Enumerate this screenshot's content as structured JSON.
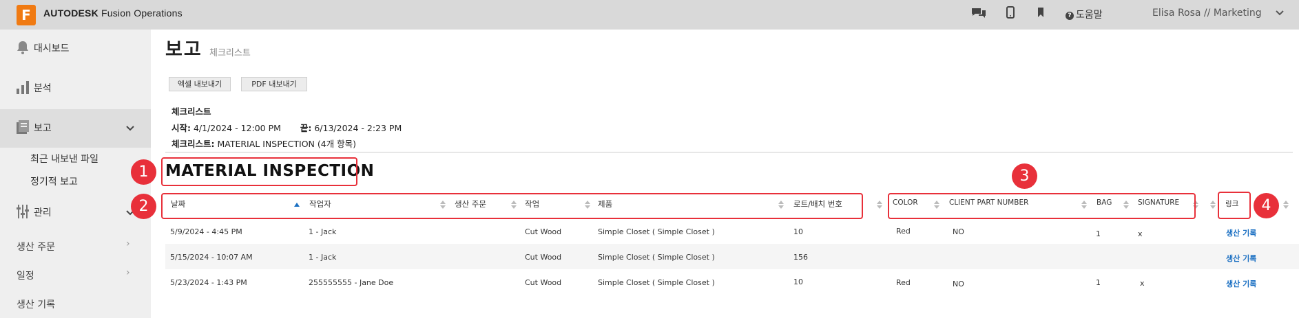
{
  "topbar": {
    "logo_letter": "F",
    "brand_bold": "AUTODESK",
    "brand_rest": " Fusion Operations",
    "help_label": "도움말",
    "user_label": "Elisa Rosa // Marketing",
    "icons": [
      "chat-icon",
      "mobile-icon",
      "bookmark-icon",
      "help-icon"
    ]
  },
  "sidebar": {
    "dashboard": "대시보드",
    "analysis": "분석",
    "report": "보고",
    "report_sub": [
      "최근 내보낸 파일",
      "정기적 보고"
    ],
    "manage": "관리",
    "work_order": "생산 주문",
    "schedule": "일정",
    "production_log": "생산 기록"
  },
  "page": {
    "title": "보고",
    "subtitle": "체크리스트",
    "export_excel": "엑셀 내보내기",
    "export_pdf": "PDF 내보내기"
  },
  "info": {
    "heading": "체크리스트",
    "start_label": "시작:",
    "start_value": " 4/1/2024 - 12:00 PM",
    "end_label": "끝:",
    "end_value": " 6/13/2024 - 2:23 PM",
    "checklist_label": "체크리스트:",
    "checklist_value": " MATERIAL INSPECTION (4개 항목)"
  },
  "section_title": "MATERIAL INSPECTION",
  "table": {
    "headers": [
      "날짜",
      "작업자",
      "생산 주문",
      "작업",
      "제품",
      "로트/배치 번호",
      "COLOR",
      "CLIENT PART NUMBER",
      "BAG",
      "SIGNATURE",
      "링크"
    ],
    "rows": [
      {
        "date": "5/9/2024 - 4:45 PM",
        "operator": "1 - Jack",
        "work_order": "",
        "operation": "Cut Wood",
        "product": "Simple Closet ( Simple Closet )",
        "lot": "10",
        "color": "Red",
        "client_part": "NO",
        "bag": "1",
        "signature": "x",
        "link": "생산 기록"
      },
      {
        "date": "5/15/2024 - 10:07 AM",
        "operator": "1 - Jack",
        "work_order": "",
        "operation": "Cut Wood",
        "product": "Simple Closet ( Simple Closet )",
        "lot": "156",
        "color": "",
        "client_part": "",
        "bag": "",
        "signature": "",
        "link": "생산 기록"
      },
      {
        "date": "5/23/2024 - 1:43 PM",
        "operator": "255555555 - Jane Doe",
        "work_order": "",
        "operation": "Cut Wood",
        "product": "Simple Closet ( Simple Closet )",
        "lot": "10",
        "color": "Red",
        "client_part": "NO",
        "bag": "1",
        "signature": "x",
        "link": "생산 기록"
      }
    ]
  },
  "annotations": [
    "1",
    "2",
    "3",
    "4"
  ],
  "colors": {
    "accent": "#f07a12",
    "annotation": "#e8303a",
    "link": "#1a6fc2"
  }
}
